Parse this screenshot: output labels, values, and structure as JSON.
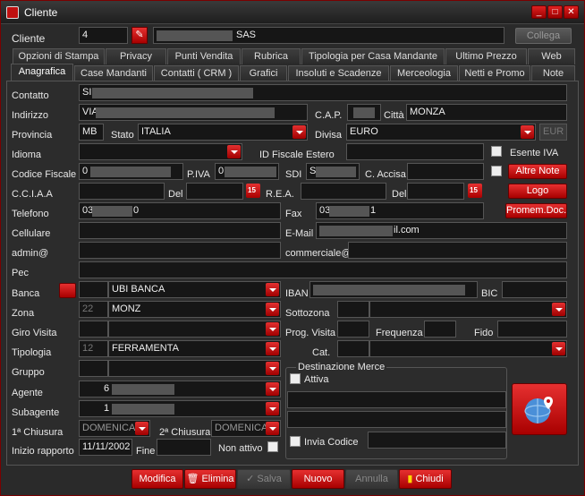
{
  "window": {
    "title": "Cliente",
    "minimize": "_",
    "maximize": "□",
    "close": "✕"
  },
  "header": {
    "label": "Cliente",
    "code": "4",
    "name": "SAS",
    "link_button": "Collega"
  },
  "tabs_row1": [
    "Opzioni di Stampa",
    "Privacy",
    "Punti Vendita",
    "Rubrica",
    "Tipologia per Casa Mandante",
    "Ultimo Prezzo",
    "Web"
  ],
  "tabs_row2": [
    "Anagrafica",
    "Case Mandanti",
    "Contatti ( CRM )",
    "Grafici",
    "Insoluti e Scadenze",
    "Merceologia",
    "Netti e Promo",
    "Note"
  ],
  "form": {
    "contatto": {
      "label": "Contatto",
      "value": "SI"
    },
    "indirizzo": {
      "label": "Indirizzo",
      "value": "VIA"
    },
    "cap": {
      "label": "C.A.P."
    },
    "citta": {
      "label": "Città",
      "value": "MONZA"
    },
    "provincia": {
      "label": "Provincia",
      "value": "MB"
    },
    "stato": {
      "label": "Stato",
      "value": "ITALIA"
    },
    "divisa": {
      "label": "Divisa",
      "value": "EURO",
      "code": "EUR"
    },
    "idioma": {
      "label": "Idioma"
    },
    "id_fiscale": {
      "label": "ID Fiscale Estero"
    },
    "esente_iva": {
      "label": "Esente IVA"
    },
    "codice_fiscale": {
      "label": "Codice Fiscale",
      "value": "0"
    },
    "piva": {
      "label": "P.IVA",
      "value": "0"
    },
    "sdi": {
      "label": "SDI",
      "value": "S"
    },
    "accisa": {
      "label": "C. Accisa"
    },
    "altre_note": "Altre Note",
    "cciaa": {
      "label": "C.C.I.A.A"
    },
    "del1": {
      "label": "Del"
    },
    "rea": {
      "label": "R.E.A."
    },
    "del2": {
      "label": "Del"
    },
    "logo": "Logo",
    "telefono": {
      "label": "Telefono",
      "value_start": "03",
      "value_end": "0"
    },
    "fax": {
      "label": "Fax",
      "value_start": "03",
      "value_end": "1"
    },
    "promemoria": "Promem.Doc.",
    "cellulare": {
      "label": "Cellulare"
    },
    "email": {
      "label": "E-Mail",
      "value_start": "",
      "value_end": "il.com"
    },
    "admin": {
      "label": "admin@"
    },
    "commerciale": {
      "label": "commerciale@"
    },
    "pec": {
      "label": "Pec"
    },
    "banca": {
      "label": "Banca",
      "value": "UBI BANCA"
    },
    "iban": {
      "label": "IBAN"
    },
    "bic": {
      "label": "BIC"
    },
    "zona": {
      "label": "Zona",
      "code": "22",
      "value": "MONZ"
    },
    "sottozona": {
      "label": "Sottozona"
    },
    "giro_visita": {
      "label": "Giro Visita"
    },
    "prog_visita": {
      "label": "Prog. Visita"
    },
    "frequenza": {
      "label": "Frequenza"
    },
    "fido": {
      "label": "Fido"
    },
    "tipologia": {
      "label": "Tipologia",
      "code": "12",
      "value": "FERRAMENTA"
    },
    "cat": {
      "label": "Cat."
    },
    "gruppo": {
      "label": "Gruppo"
    },
    "agente": {
      "label": "Agente",
      "code": "6"
    },
    "subagente": {
      "label": "Subagente",
      "code": "1"
    },
    "chiusura1": {
      "label": "1ª Chiusura",
      "value": "DOMENICA"
    },
    "chiusura2": {
      "label": "2ª Chiusura",
      "value": "DOMENICA"
    },
    "inizio": {
      "label": "Inizio rapporto",
      "value": "11/11/2002"
    },
    "fine": {
      "label": "Fine"
    },
    "non_attivo": {
      "label": "Non attivo"
    },
    "destinazione": {
      "title": "Destinazione Merce",
      "attiva": "Attiva",
      "invia": "Invia Codice"
    }
  },
  "footer": {
    "modifica": "Modifica",
    "elimina": "Elimina",
    "salva": "Salva",
    "nuovo": "Nuovo",
    "annulla": "Annulla",
    "chiudi": "Chiudi"
  },
  "colors": {
    "accent": "#c01010",
    "background": "#2a2a2a",
    "field": "#161616"
  }
}
